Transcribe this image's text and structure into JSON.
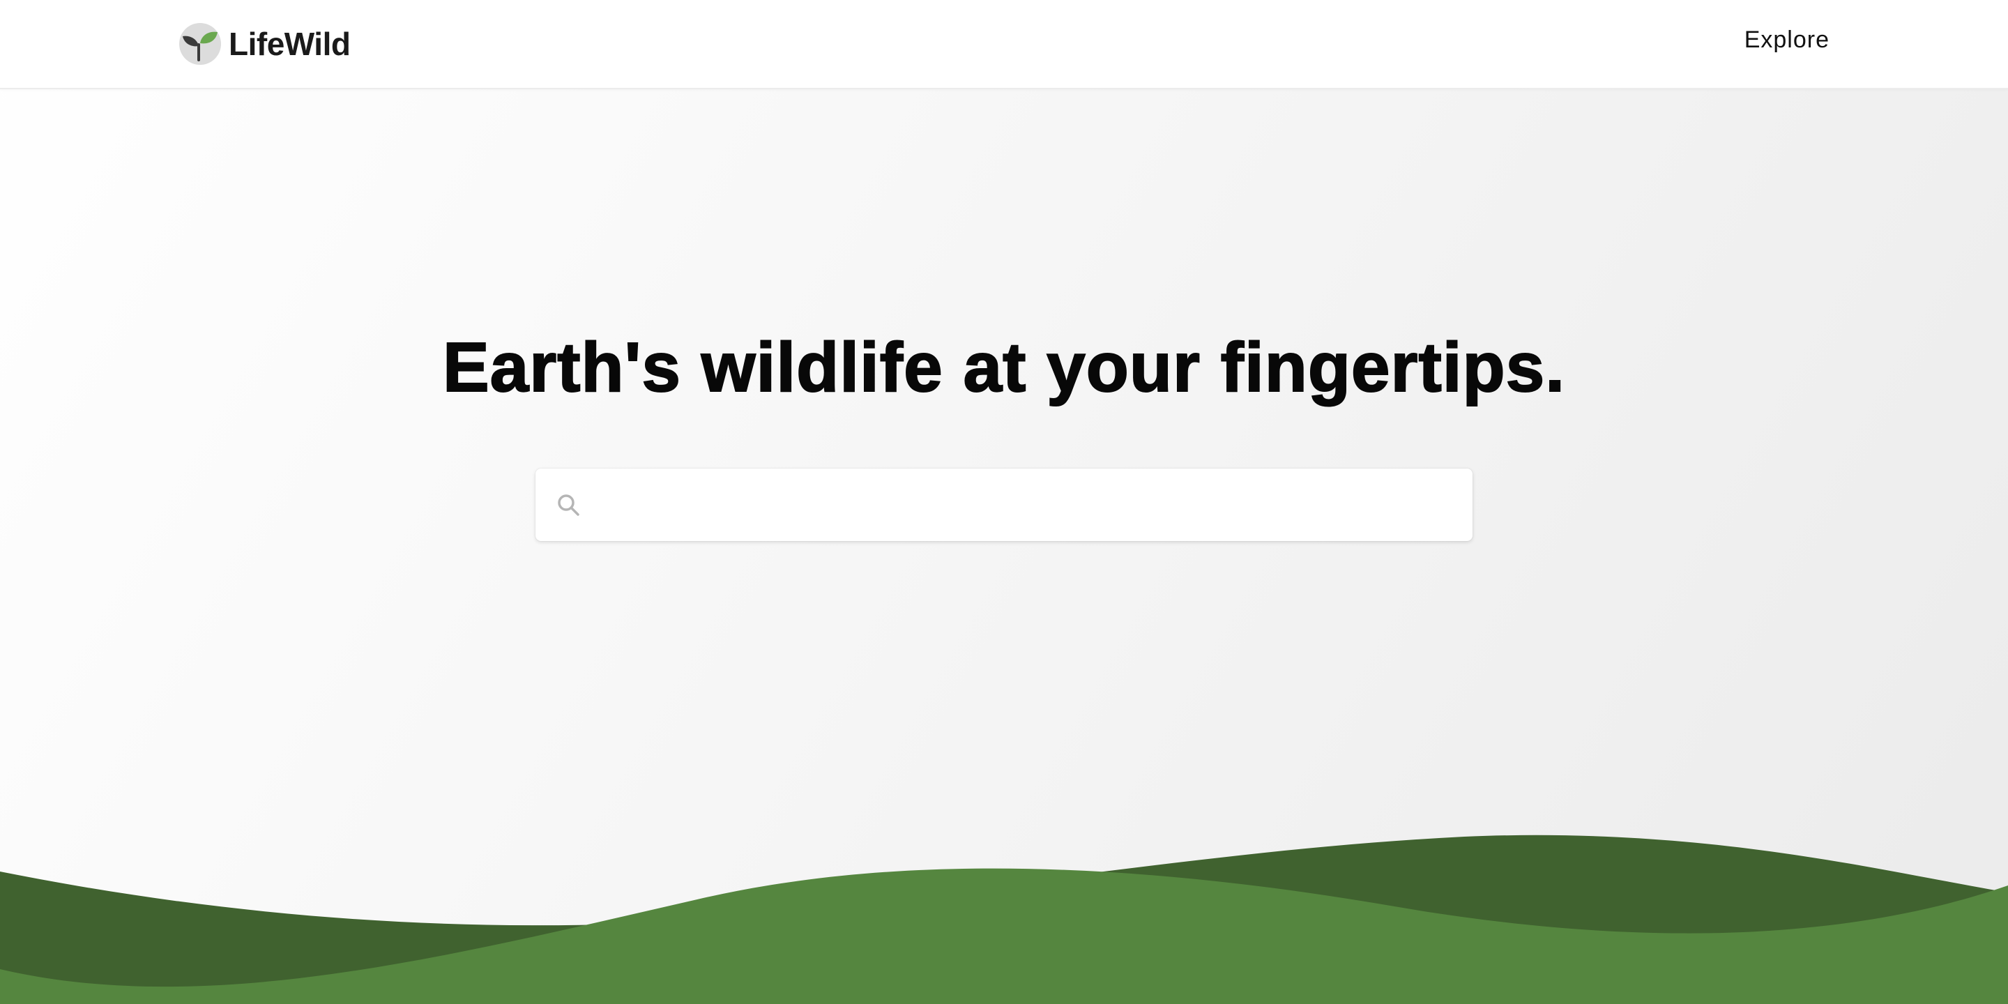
{
  "header": {
    "brand_name": "LifeWild",
    "logo_icon": "sprout-logo-icon",
    "nav_explore": "Explore"
  },
  "hero": {
    "title": "Earth's wildlife at your fingertips."
  },
  "search": {
    "icon": "search-icon",
    "value": "",
    "placeholder": ""
  },
  "colors": {
    "hill_dark": "#40622f",
    "hill_light": "#55863f",
    "logo_circle": "#dcdcdc",
    "logo_leaf_dark": "#3a3a3a",
    "logo_leaf_green": "#6aa84f"
  }
}
